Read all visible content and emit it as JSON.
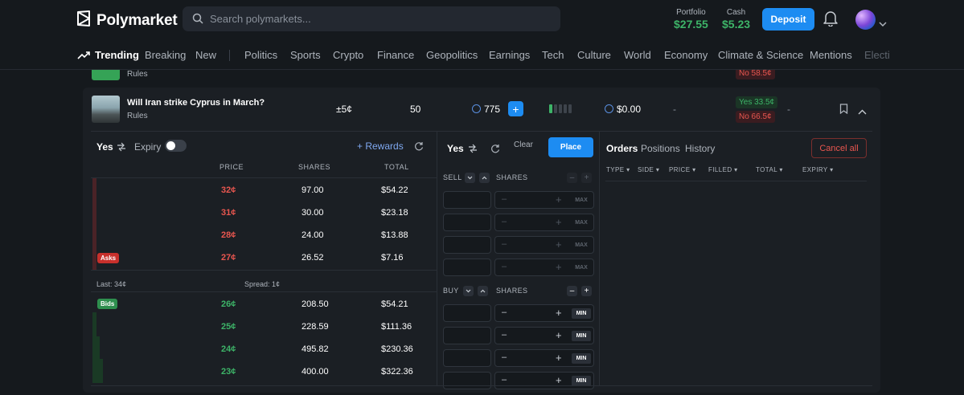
{
  "header": {
    "brand": "Polymarket",
    "search_placeholder": "Search polymarkets...",
    "portfolio_label": "Portfolio",
    "portfolio_value": "$27.55",
    "cash_label": "Cash",
    "cash_value": "$5.23",
    "deposit_label": "Deposit"
  },
  "nav": {
    "trending": "Trending",
    "items": [
      "Breaking",
      "New",
      "Politics",
      "Sports",
      "Crypto",
      "Finance",
      "Geopolitics",
      "Earnings",
      "Tech",
      "Culture",
      "World",
      "Economy",
      "Climate & Science",
      "Mentions",
      "Electi"
    ]
  },
  "prev_market": {
    "rules": "Rules",
    "no_price": "No 58.5¢"
  },
  "market": {
    "title": "Will Iran strike Cyprus in March?",
    "rules": "Rules",
    "spread": "±5¢",
    "count": "50",
    "shares": "775",
    "value": "$0.00",
    "dash1": "-",
    "yes_price": "Yes 33.5¢",
    "no_price": "No 66.5¢",
    "dash2": "-"
  },
  "orderbook": {
    "outcome": "Yes",
    "expiry_label": "Expiry",
    "rewards_label": "+ Rewards",
    "col_price": "PRICE",
    "col_shares": "SHARES",
    "col_total": "TOTAL",
    "asks": [
      {
        "price": "32¢",
        "shares": "97.00",
        "total": "$54.22"
      },
      {
        "price": "31¢",
        "shares": "30.00",
        "total": "$23.18"
      },
      {
        "price": "28¢",
        "shares": "24.00",
        "total": "$13.88"
      },
      {
        "price": "27¢",
        "shares": "26.52",
        "total": "$7.16"
      }
    ],
    "asks_tag": "Asks",
    "last": "Last: 34¢",
    "spread": "Spread: 1¢",
    "bids_tag": "Bids",
    "bids": [
      {
        "price": "26¢",
        "shares": "208.50",
        "total": "$54.21"
      },
      {
        "price": "25¢",
        "shares": "228.59",
        "total": "$111.36"
      },
      {
        "price": "24¢",
        "shares": "495.82",
        "total": "$230.36"
      },
      {
        "price": "23¢",
        "shares": "400.00",
        "total": "$322.36"
      }
    ]
  },
  "order_entry": {
    "outcome": "Yes",
    "clear_label": "Clear",
    "place_label": "Place",
    "sell_label": "SELL",
    "buy_label": "BUY",
    "shares_label": "SHARES",
    "minus": "–",
    "plus": "+",
    "max_label": "MAX",
    "min_label": "MIN"
  },
  "orders": {
    "tab_orders": "Orders",
    "tab_positions": "Positions",
    "tab_history": "History",
    "cancel_all": "Cancel all",
    "cols": [
      "TYPE",
      "SIDE",
      "PRICE",
      "FILLED",
      "TOTAL",
      "EXPIRY"
    ]
  },
  "colors": {
    "accent": "#1d8cf2",
    "green": "#3db468",
    "red": "#e8564f",
    "background": "#15191d"
  }
}
